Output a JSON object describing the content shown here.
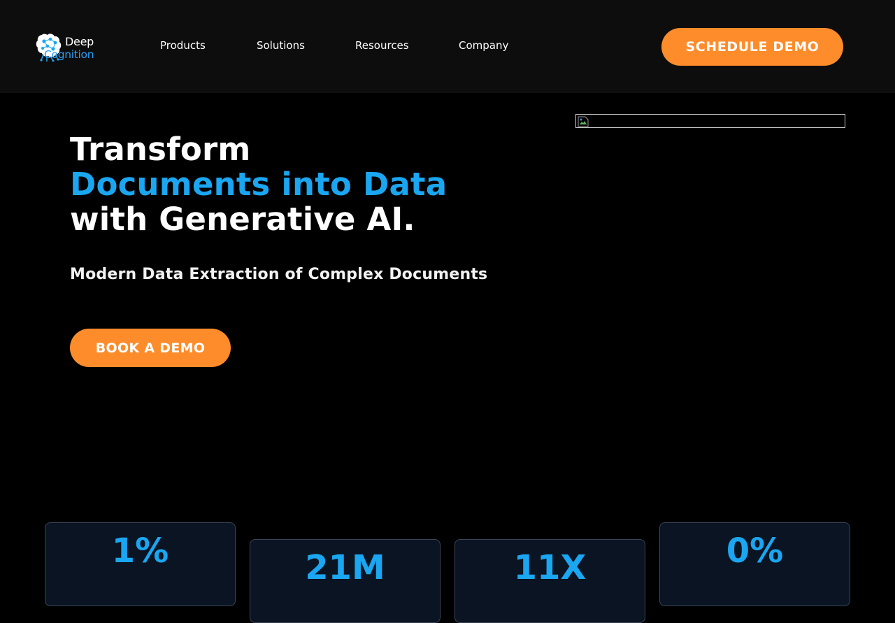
{
  "brand": {
    "name_line1": "Deep",
    "name_line2": "Cognition",
    "accent_color": "#1aa6f0",
    "cta_color": "#ff8c2b"
  },
  "nav": {
    "items": [
      {
        "label": "Products"
      },
      {
        "label": "Solutions"
      },
      {
        "label": "Resources"
      },
      {
        "label": "Company"
      }
    ],
    "cta_label": "SCHEDULE DEMO"
  },
  "hero": {
    "title_line1": "Transform",
    "title_line2": "Documents into Data",
    "title_line3": "with Generative AI.",
    "subtitle": "Modern Data Extraction of Complex Documents",
    "cta_label": "BOOK A DEMO",
    "image_icon": "broken-image-icon"
  },
  "stats": [
    {
      "value": "1%"
    },
    {
      "value": "21M"
    },
    {
      "value": "11X"
    },
    {
      "value": "0%"
    }
  ]
}
